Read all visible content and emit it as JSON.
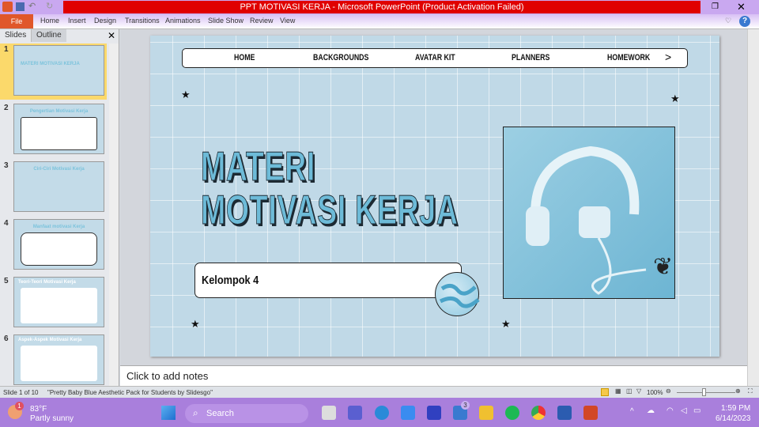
{
  "window": {
    "title": "PPT MOTIVASI KERJA  -  Microsoft PowerPoint (Product Activation Failed)"
  },
  "ribbon": {
    "file": "File",
    "tabs": [
      "Home",
      "Insert",
      "Design",
      "Transitions",
      "Animations",
      "Slide Show",
      "Review",
      "View"
    ]
  },
  "pane": {
    "tabs": [
      "Slides",
      "Outline"
    ],
    "close": "✕"
  },
  "thumbnails": [
    {
      "num": "1",
      "title": "MATERI MOTIVASI KERJA"
    },
    {
      "num": "2",
      "title": "Pengertian Motivasi Kerja"
    },
    {
      "num": "3",
      "title": "Ciri-Ciri Motivasi Kerja"
    },
    {
      "num": "4",
      "title": "Manfaat motivasi Kerja"
    },
    {
      "num": "5",
      "title": "Teori-Teori Motivasi Kerja"
    },
    {
      "num": "6",
      "title": "Aspek-Aspek Motivasi Kerja"
    }
  ],
  "slide": {
    "nav": [
      "HOME",
      "BACKGROUNDS",
      "AVATAR KIT",
      "PLANNERS",
      "HOMEWORK"
    ],
    "nav_next": ">",
    "title_line1": "MATERI",
    "title_line2": "MOTIVASI KERJA",
    "subtitle": "Kelompok 4"
  },
  "notes": {
    "placeholder": "Click to add notes"
  },
  "status": {
    "slide": "Slide 1 of 10",
    "theme": "\"Pretty Baby Blue Aesthetic Pack for Students by Slidesgo\"",
    "zoom": "100%"
  },
  "taskbar": {
    "temp": "83°F",
    "weather": "Partly sunny",
    "badge": "1",
    "search": "Search",
    "mail_badge": "3",
    "time": "1:59 PM",
    "date": "6/14/2023"
  },
  "colors": {
    "accent": "#e00000",
    "slide_bg": "#c0d9e7",
    "title": "#6dbbd8",
    "taskbar": "#a97fdc"
  }
}
